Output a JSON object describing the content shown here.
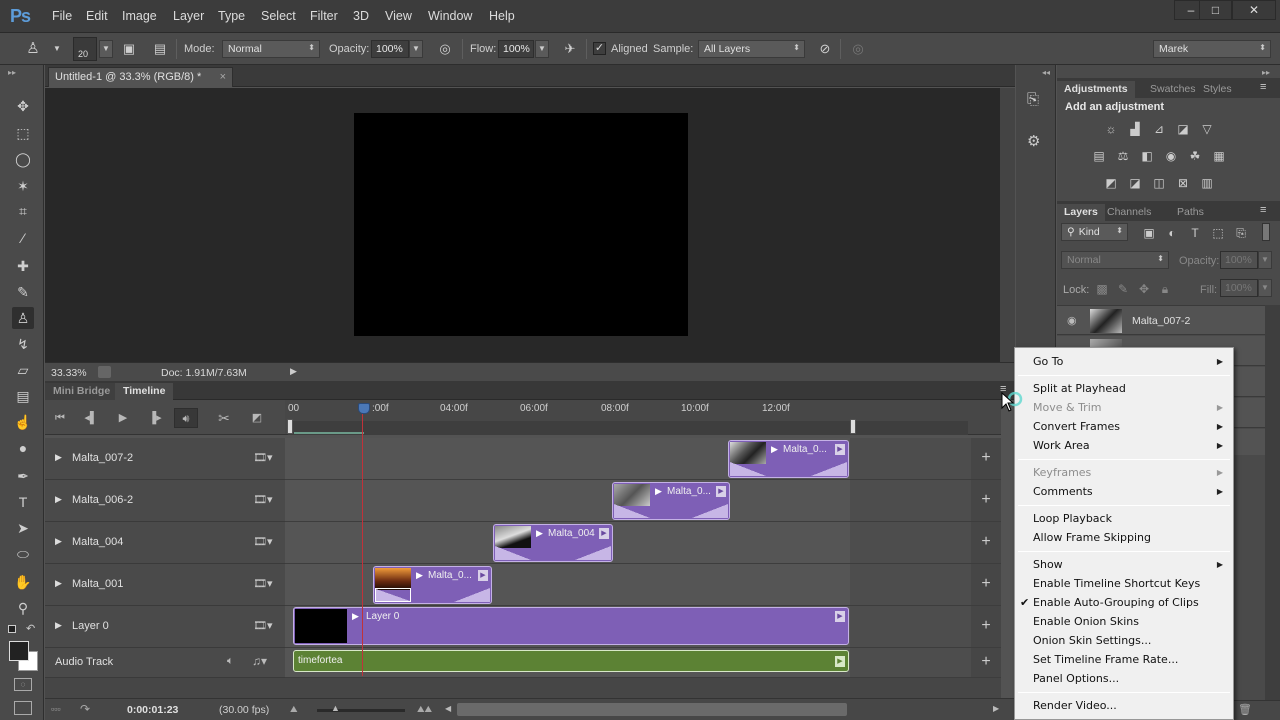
{
  "app": {
    "logo": "Ps"
  },
  "menubar": {
    "items": [
      "File",
      "Edit",
      "Image",
      "Layer",
      "Type",
      "Select",
      "Filter",
      "3D",
      "View",
      "Window",
      "Help"
    ],
    "window_controls": {
      "minimize": "–",
      "maximize": "□",
      "close": "✕"
    }
  },
  "options_bar": {
    "brush_size": "20",
    "mode_label": "Mode:",
    "mode_value": "Normal",
    "opacity_label": "Opacity:",
    "opacity_value": "100%",
    "flow_label": "Flow:",
    "flow_value": "100%",
    "aligned_label": "Aligned",
    "aligned_checked": true,
    "sample_label": "Sample:",
    "sample_value": "All Layers",
    "workspace_value": "Marek"
  },
  "tools": [
    {
      "name": "move-tool",
      "glyph": "✥"
    },
    {
      "name": "marquee-tool",
      "glyph": "⬚"
    },
    {
      "name": "lasso-tool",
      "glyph": "◯"
    },
    {
      "name": "magic-wand-tool",
      "glyph": "✶"
    },
    {
      "name": "crop-tool",
      "glyph": "⌗"
    },
    {
      "name": "eyedropper-tool",
      "glyph": "⁄"
    },
    {
      "name": "healing-brush-tool",
      "glyph": "✚"
    },
    {
      "name": "brush-tool",
      "glyph": "✎"
    },
    {
      "name": "clone-stamp-tool",
      "glyph": "♙"
    },
    {
      "name": "history-brush-tool",
      "glyph": "↯"
    },
    {
      "name": "eraser-tool",
      "glyph": "▱"
    },
    {
      "name": "gradient-tool",
      "glyph": "▤"
    },
    {
      "name": "blur-tool",
      "glyph": "☝"
    },
    {
      "name": "dodge-tool",
      "glyph": "●"
    },
    {
      "name": "pen-tool",
      "glyph": "✒"
    },
    {
      "name": "type-tool",
      "glyph": "T"
    },
    {
      "name": "path-selection-tool",
      "glyph": "➤"
    },
    {
      "name": "ellipse-tool",
      "glyph": "⬭"
    },
    {
      "name": "hand-tool",
      "glyph": "✋"
    },
    {
      "name": "zoom-tool",
      "glyph": "⚲"
    }
  ],
  "document": {
    "tab_title": "Untitled-1 @ 33.3% (RGB/8) *",
    "close_glyph": "×",
    "zoom_level": "33.33%",
    "doc_info": "Doc: 1.91M/7.63M"
  },
  "timeline": {
    "tabs": [
      "Mini Bridge",
      "Timeline"
    ],
    "active_tab": "Timeline",
    "ruler_labels": [
      "00",
      ":00f",
      "04:00f",
      "06:00f",
      "08:00f",
      "10:00f",
      "12:00f"
    ],
    "tracks": [
      {
        "name": "Malta_007-2",
        "clip_label": "Malta_0..."
      },
      {
        "name": "Malta_006-2",
        "clip_label": "Malta_0..."
      },
      {
        "name": "Malta_004",
        "clip_label": "Malta_004"
      },
      {
        "name": "Malta_001",
        "clip_label": "Malta_0..."
      },
      {
        "name": "Layer 0",
        "clip_label": "Layer 0"
      }
    ],
    "audio_track": {
      "name": "Audio Track",
      "clip_label": "timefortea"
    },
    "current_time": "0:00:01:23",
    "fps": "(30.00 fps)",
    "clip_color": "#7e5fb6",
    "audio_color": "#5c8234",
    "playhead_color": "#c0323a"
  },
  "right_panels": {
    "adjustments_tabs": [
      "Adjustments",
      "Swatches",
      "Styles"
    ],
    "add_adjustment": "Add an adjustment",
    "layers_tabs": [
      "Layers",
      "Channels",
      "Paths"
    ],
    "filter_kind": "Kind",
    "blend_mode": "Normal",
    "opacity_label": "Opacity:",
    "opacity_value": "100%",
    "lock_label": "Lock:",
    "fill_label": "Fill:",
    "fill_value": "100%",
    "layers": [
      {
        "name": "Malta_007-2"
      }
    ]
  },
  "context_menu": {
    "items": [
      {
        "label": "Go To",
        "submenu": true,
        "disabled": false
      },
      {
        "sep": true
      },
      {
        "label": "Split at Playhead",
        "submenu": false,
        "disabled": false
      },
      {
        "label": "Move & Trim",
        "submenu": true,
        "disabled": true
      },
      {
        "label": "Convert Frames",
        "submenu": true,
        "disabled": false
      },
      {
        "label": "Work Area",
        "submenu": true,
        "disabled": false
      },
      {
        "sep": true
      },
      {
        "label": "Keyframes",
        "submenu": true,
        "disabled": true
      },
      {
        "label": "Comments",
        "submenu": true,
        "disabled": false
      },
      {
        "sep": true
      },
      {
        "label": "Loop Playback",
        "submenu": false,
        "disabled": false
      },
      {
        "label": "Allow Frame Skipping",
        "submenu": false,
        "disabled": false
      },
      {
        "sep": true
      },
      {
        "label": "Show",
        "submenu": true,
        "disabled": false
      },
      {
        "label": "Enable Timeline Shortcut Keys",
        "submenu": false,
        "disabled": false
      },
      {
        "label": "Enable Auto-Grouping of Clips",
        "submenu": false,
        "disabled": false,
        "checked": true
      },
      {
        "label": "Enable Onion Skins",
        "submenu": false,
        "disabled": false
      },
      {
        "label": "Onion Skin Settings...",
        "submenu": false,
        "disabled": false
      },
      {
        "label": "Set Timeline Frame Rate...",
        "submenu": false,
        "disabled": false
      },
      {
        "label": "Panel Options...",
        "submenu": false,
        "disabled": false
      },
      {
        "sep": true
      },
      {
        "label": "Render Video...",
        "submenu": false,
        "disabled": false
      }
    ]
  }
}
